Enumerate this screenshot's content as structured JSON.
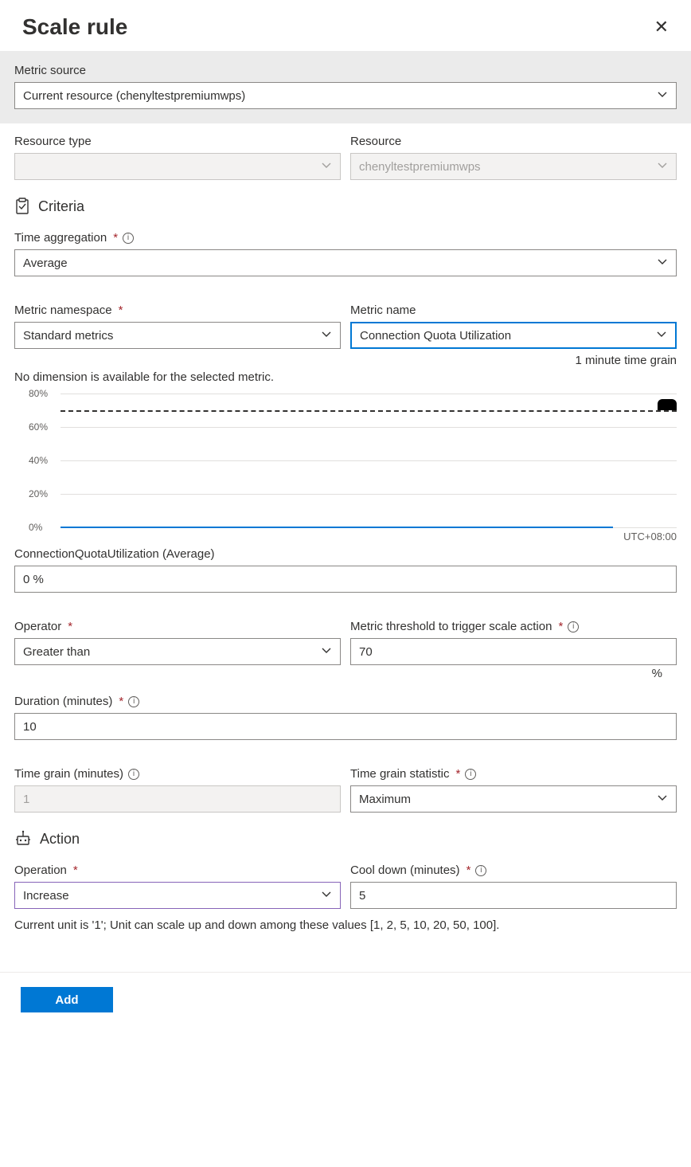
{
  "header": {
    "title": "Scale rule"
  },
  "metricSource": {
    "label": "Metric source",
    "value": "Current resource (chenyltestpremiumwps)"
  },
  "resourceType": {
    "label": "Resource type",
    "value": ""
  },
  "resource": {
    "label": "Resource",
    "value": "chenyltestpremiumwps"
  },
  "criteria": {
    "title": "Criteria",
    "timeAggregation": {
      "label": "Time aggregation",
      "value": "Average"
    },
    "metricNamespace": {
      "label": "Metric namespace",
      "value": "Standard metrics"
    },
    "metricName": {
      "label": "Metric name",
      "value": "Connection Quota Utilization",
      "grainNote": "1 minute time grain"
    },
    "noDimension": "No dimension is available for the selected metric.",
    "readoutLabel": "ConnectionQuotaUtilization (Average)",
    "readoutValue": "0 %",
    "operator": {
      "label": "Operator",
      "value": "Greater than"
    },
    "threshold": {
      "label": "Metric threshold to trigger scale action",
      "value": "70",
      "unit": "%"
    },
    "duration": {
      "label": "Duration (minutes)",
      "value": "10"
    },
    "timeGrain": {
      "label": "Time grain (minutes)",
      "value": "1"
    },
    "timeGrainStat": {
      "label": "Time grain statistic",
      "value": "Maximum"
    }
  },
  "action": {
    "title": "Action",
    "operation": {
      "label": "Operation",
      "value": "Increase"
    },
    "cooldown": {
      "label": "Cool down (minutes)",
      "value": "5"
    },
    "unitNote": "Current unit is '1'; Unit can scale up and down among these values [1, 2, 5, 10, 20, 50, 100]."
  },
  "footer": {
    "addLabel": "Add"
  },
  "chart_data": {
    "type": "line",
    "title": "",
    "xlabel": "",
    "ylabel": "",
    "ylim": [
      0,
      80
    ],
    "y_ticks": [
      "0%",
      "20%",
      "40%",
      "60%",
      "80%"
    ],
    "threshold_line": 70,
    "timezone": "UTC+08:00",
    "series": [
      {
        "name": "ConnectionQuotaUtilization (Average)",
        "values": [
          0,
          0,
          0,
          0,
          0,
          0,
          0,
          0,
          0,
          0,
          0,
          0,
          0,
          0,
          0,
          0,
          0,
          0,
          0,
          0,
          0,
          0,
          0,
          0,
          0,
          0,
          0,
          0,
          0,
          0,
          0,
          0,
          0,
          0,
          0,
          0,
          0,
          0,
          0,
          0,
          0,
          0,
          0,
          0,
          0,
          0,
          0,
          0,
          0,
          0,
          0,
          0,
          0,
          0,
          0,
          0,
          0,
          0,
          0,
          0
        ]
      }
    ]
  }
}
